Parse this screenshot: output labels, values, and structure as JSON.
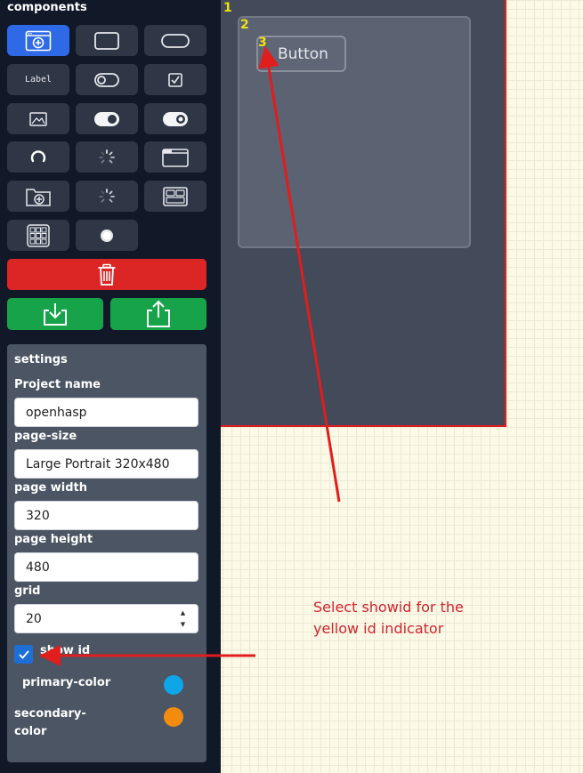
{
  "sidebar": {
    "title": "components",
    "tools": [
      {
        "icon": "add-page-icon",
        "active": true
      },
      {
        "icon": "rectangle-icon",
        "active": false
      },
      {
        "icon": "rounded-rectangle-icon",
        "active": false
      },
      {
        "icon": "label-icon",
        "text": "Label",
        "active": false
      },
      {
        "icon": "switch-icon",
        "active": false
      },
      {
        "icon": "checkbox-icon",
        "active": false
      },
      {
        "icon": "image-icon",
        "active": false
      },
      {
        "icon": "toggle-icon",
        "active": false
      },
      {
        "icon": "toggle-alt-icon",
        "active": false
      },
      {
        "icon": "arc-icon",
        "active": false
      },
      {
        "icon": "spinner-icon",
        "active": false
      },
      {
        "icon": "tabview-icon",
        "active": false
      },
      {
        "icon": "add-folder-icon",
        "active": false
      },
      {
        "icon": "spinner-alt-icon",
        "active": false
      },
      {
        "icon": "buttonmatrix-icon",
        "active": false
      },
      {
        "icon": "keypad-icon",
        "active": false
      },
      {
        "icon": "led-icon",
        "active": false
      }
    ],
    "actions": {
      "delete": "trash-icon",
      "import": "download-icon",
      "export": "upload-icon"
    }
  },
  "settings": {
    "title": "settings",
    "project_name_label": "Project name",
    "project_name_value": "openhasp",
    "page_size_label": "page-size",
    "page_size_value": "Large Portrait 320x480",
    "page_width_label": "page width",
    "page_width_value": "320",
    "page_height_label": "page height",
    "page_height_value": "480",
    "grid_label": "grid",
    "grid_value": "20",
    "show_id_label": "show id",
    "show_id_checked": true,
    "primary_color_label": "primary-color",
    "primary_color": "#0ea5e9",
    "secondary_color_label_1": "secondary-",
    "secondary_color_label_2": "color",
    "secondary_color": "#f28c0f"
  },
  "canvas": {
    "page_id": "1",
    "container_id": "2",
    "button_id": "3",
    "button_label": "Button"
  },
  "annotation": {
    "line1": "Select showid for the",
    "line2": "yellow id indicator"
  },
  "colors": {
    "accent": "#2f6ae6",
    "danger": "#dc2626",
    "success": "#16a34a",
    "id_indicator": "#f1e10a",
    "page_border": "#e11d1d",
    "annotation": "#d1242f"
  }
}
